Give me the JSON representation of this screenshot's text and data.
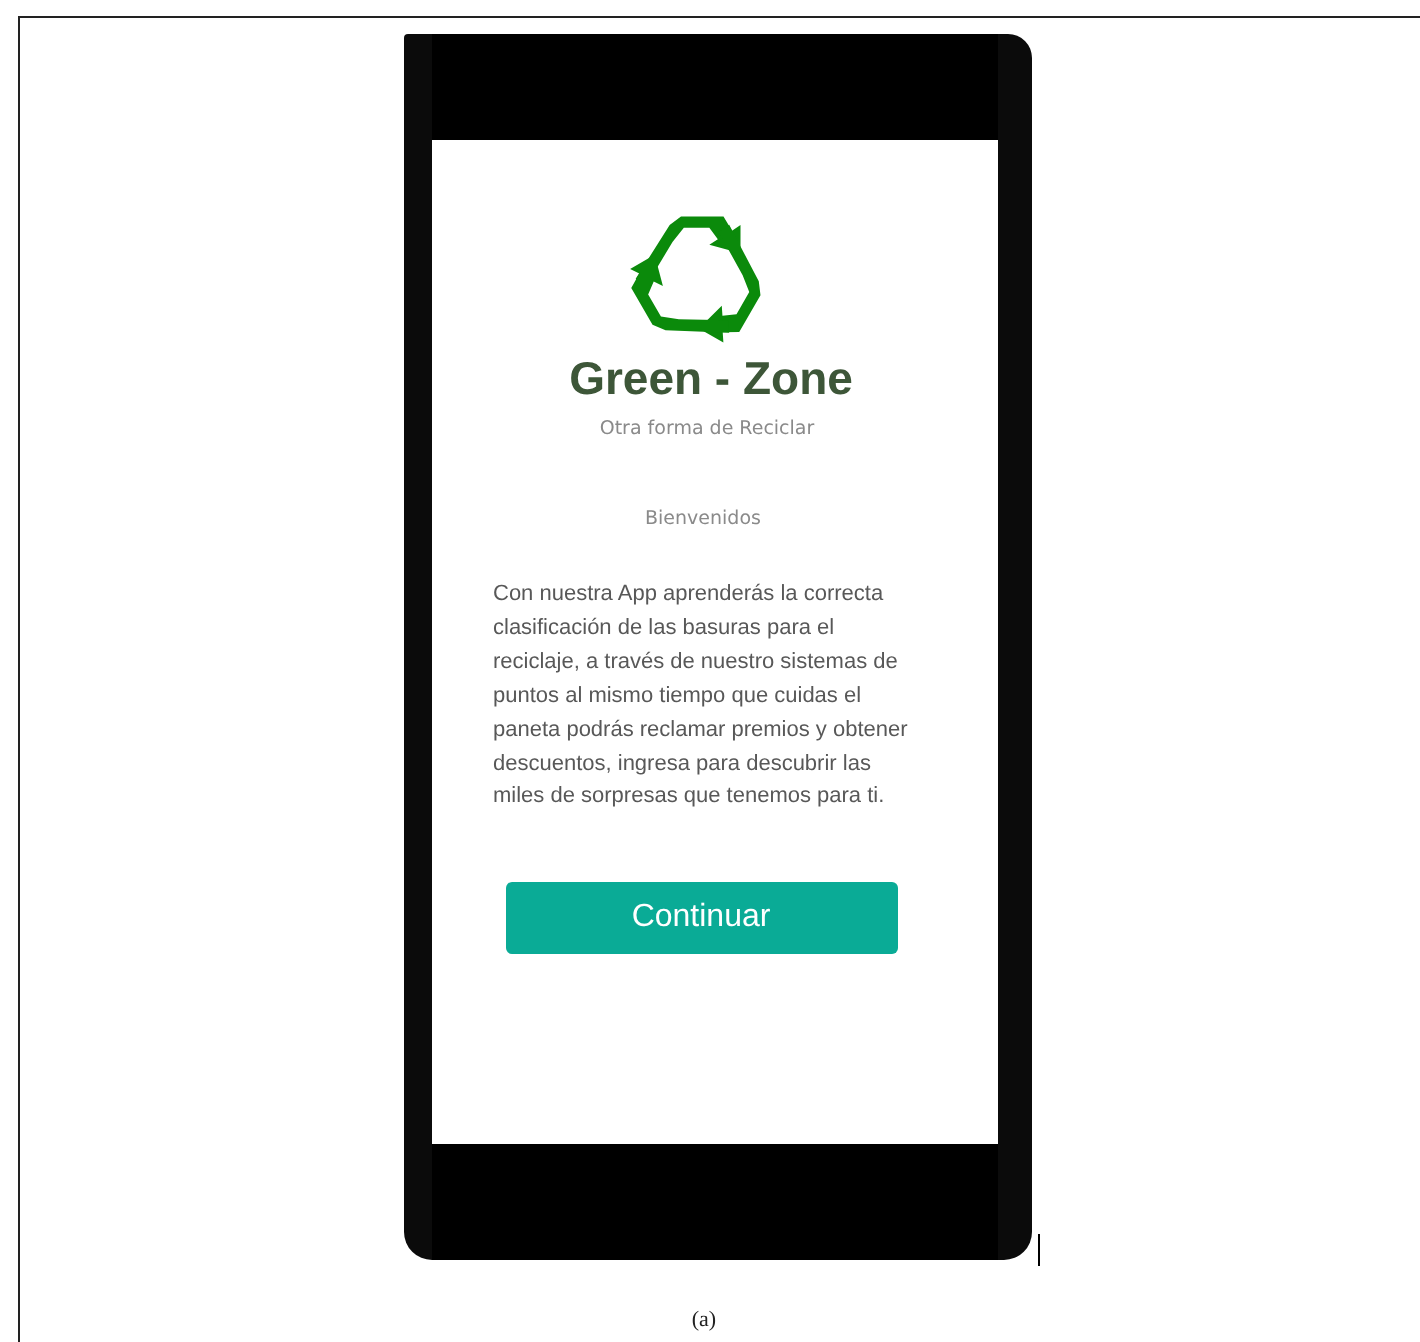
{
  "app": {
    "title": "Green - Zone",
    "subtitle": "Otra forma de Reciclar",
    "welcome": "Bienvenidos",
    "body": "Con nuestra App aprenderás la correcta clasificación de las basuras para el reciclaje, a través de nuestro sistemas de puntos al mismo tiempo que cuidas el paneta podrás reclamar premios y obtener descuentos, ingresa para descubrir las miles de sorpresas que tenemos para ti.",
    "button": "Continuar"
  },
  "caption": "(a)"
}
